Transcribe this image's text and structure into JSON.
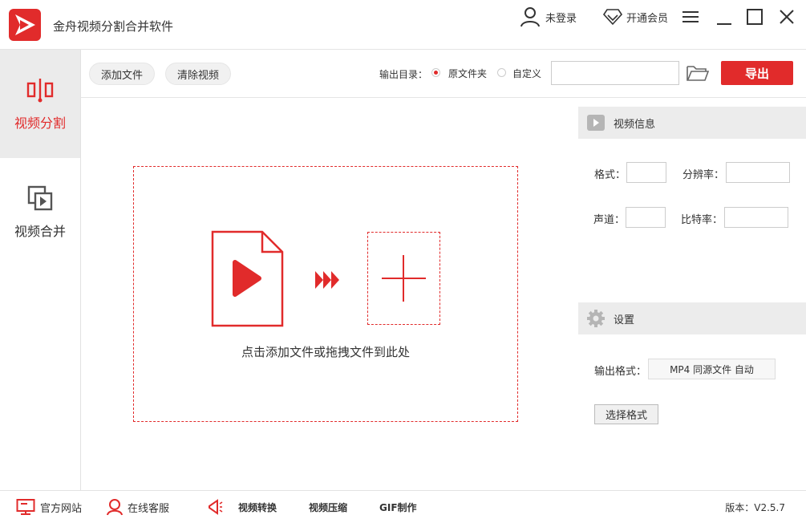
{
  "app": {
    "title": "金舟视频分割合并软件"
  },
  "header": {
    "login_label": "未登录",
    "vip_label": "开通会员"
  },
  "sidebar": {
    "items": [
      {
        "label": "视频分割",
        "active": true
      },
      {
        "label": "视频合并",
        "active": false
      }
    ]
  },
  "toolbar": {
    "add_file_label": "添加文件",
    "clear_label": "清除视频",
    "output_dir_label": "输出目录：",
    "radio_source_label": "原文件夹",
    "radio_custom_label": "自定义",
    "selected_output": "原文件夹",
    "path_value": "",
    "export_label": "导出"
  },
  "dropzone": {
    "hint": "点击添加文件或拖拽文件到此处"
  },
  "video_info": {
    "title": "视频信息",
    "format_label": "格式：",
    "format_value": "",
    "resolution_label": "分辨率：",
    "resolution_value": "",
    "channel_label": "声道：",
    "channel_value": "",
    "bitrate_label": "比特率：",
    "bitrate_value": ""
  },
  "settings": {
    "title": "设置",
    "output_format_label": "输出格式：",
    "output_format_value": "MP4 同源文件 自动",
    "choose_format_label": "选择格式"
  },
  "footer": {
    "website_label": "官方网站",
    "service_label": "在线客服",
    "links": [
      "视频转换",
      "视频压缩",
      "GIF制作"
    ],
    "version": "版本：V2.5.7"
  },
  "colors": {
    "accent": "#e12b2b",
    "panel": "#ececec"
  }
}
